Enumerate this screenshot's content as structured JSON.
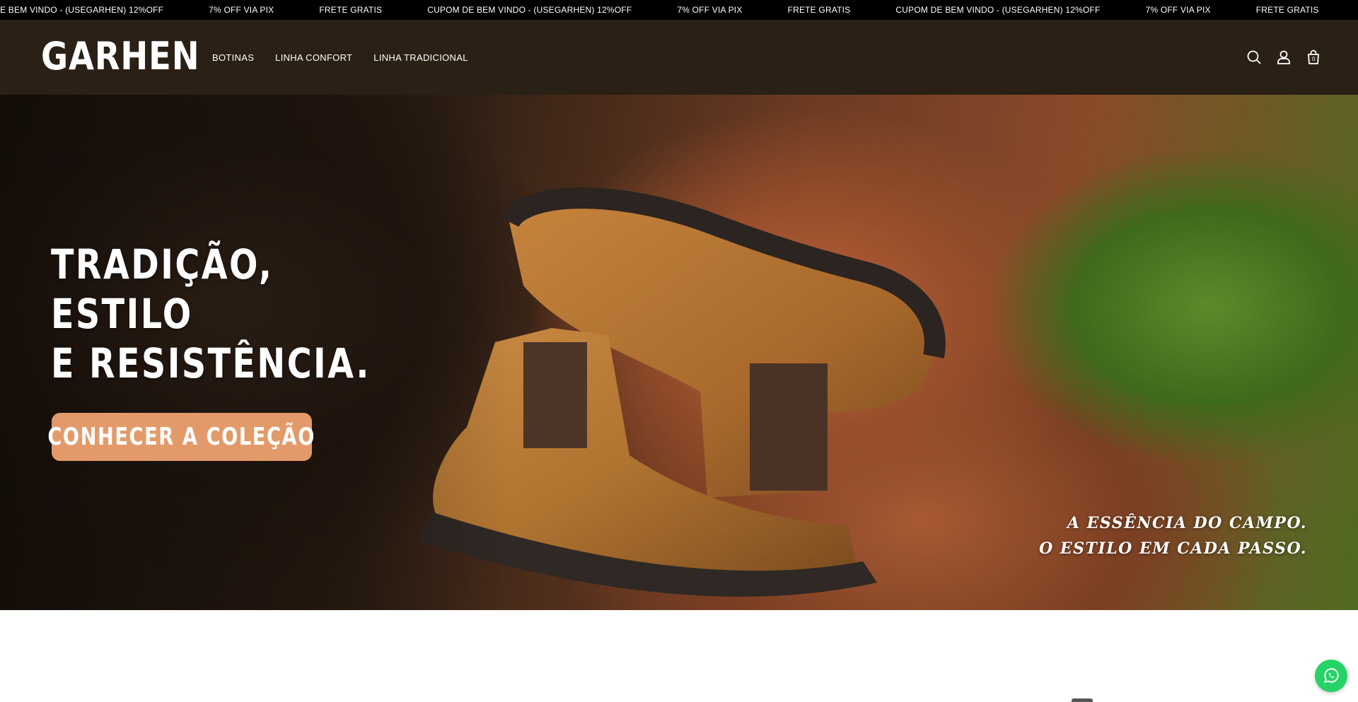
{
  "announcement": {
    "items": [
      "CUPOM DE BEM VINDO - (USEGARHEN) 12%OFF",
      "7% OFF VIA PIX",
      "FRETE GRATIS",
      "CUPOM DE BEM VINDO - (USEGARHEN) 12%OFF",
      "7% OFF VIA PIX",
      "FRETE GRATIS",
      "CUPOM DE BEM VINDO - (USEGARHEN) 12%OFF",
      "7% OFF VIA PIX",
      "FRETE GRATIS",
      "CUPOM DE BEM VINDO - (USEGARHEN) 12%OFF",
      "7% OFF VIA PIX",
      "FRETE GRATIS"
    ]
  },
  "header": {
    "logo": "GARHEN",
    "nav": [
      "BOTINAS",
      "LINHA CONFORT",
      "LINHA TRADICIONAL"
    ],
    "icons": [
      "search-icon",
      "user-icon",
      "shopping-bag-icon"
    ],
    "cart_count": "0"
  },
  "hero": {
    "title_line1": "TRADIÇÃO, ESTILO",
    "title_line2": "E RESISTÊNCIA.",
    "cta_label": "CONHECER A COLEÇÃO",
    "tagline_line1": "A ESSÊNCIA DO CAMPO.",
    "tagline_line2": "O ESTILO EM CADA PASSO."
  },
  "colors": {
    "announcement_bg": "#000000",
    "header_bg": "#2a2015",
    "cta_bg": "#e39a6a",
    "whatsapp": "#25d366"
  },
  "floating": {
    "whatsapp_icon": "whatsapp-icon"
  }
}
